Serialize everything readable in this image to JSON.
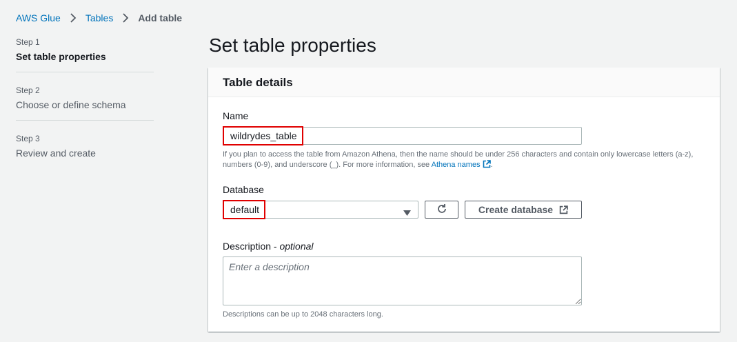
{
  "breadcrumb": {
    "items": [
      "AWS Glue",
      "Tables"
    ],
    "current": "Add table"
  },
  "steps": [
    {
      "number": "Step 1",
      "title": "Set table properties"
    },
    {
      "number": "Step 2",
      "title": "Choose or define schema"
    },
    {
      "number": "Step 3",
      "title": "Review and create"
    }
  ],
  "page_title": "Set table properties",
  "panel": {
    "title": "Table details",
    "name": {
      "label": "Name",
      "value": "wildrydes_table",
      "hint_text": "If you plan to access the table from Amazon Athena, then the name should be under 256 characters and contain only lowercase letters (a-z), numbers (0-9), and underscore (_). For more information, see ",
      "hint_link": "Athena names",
      "hint_end": "."
    },
    "database": {
      "label": "Database",
      "value": "default",
      "create_label": "Create database"
    },
    "description": {
      "label": "Description - ",
      "label_optional": "optional",
      "placeholder": "Enter a description",
      "hint": "Descriptions can be up to 2048 characters long."
    }
  },
  "colors": {
    "link": "#0073bb",
    "highlight": "#e00000",
    "background": "#f2f3f3"
  }
}
